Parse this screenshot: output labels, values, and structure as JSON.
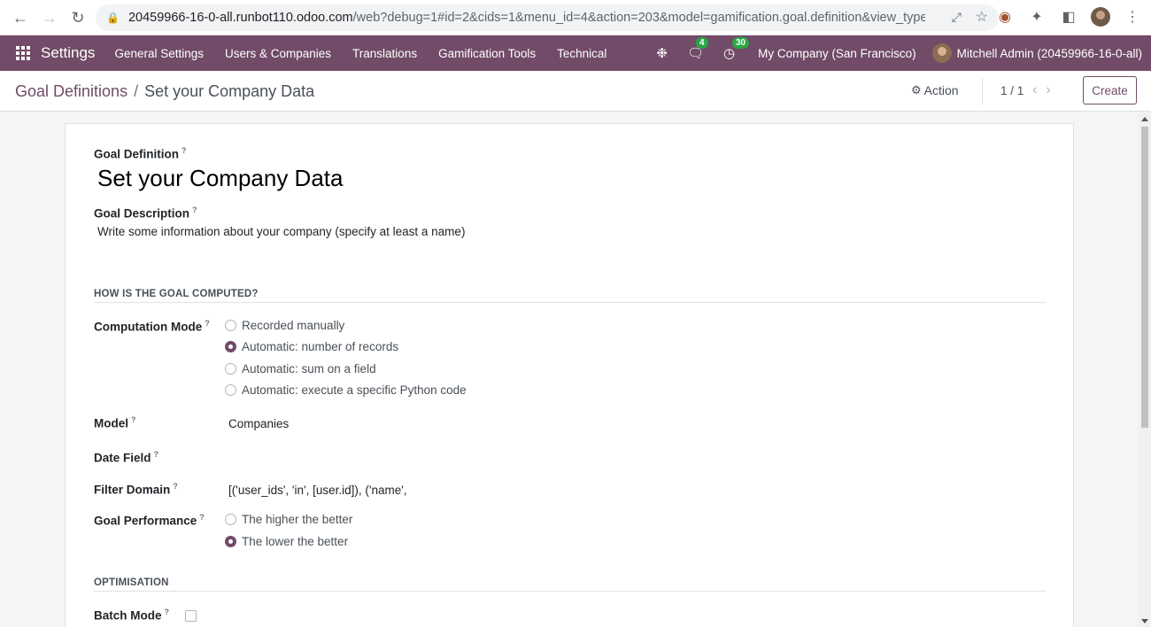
{
  "browser": {
    "url_host": "20459966-16-0-all.runbot110.odoo.com",
    "url_rest": "/web?debug=1#id=2&cids=1&menu_id=4&action=203&model=gamification.goal.definition&view_type..."
  },
  "topnav": {
    "app_name": "Settings",
    "menu": [
      "General Settings",
      "Users & Companies",
      "Translations",
      "Gamification Tools",
      "Technical"
    ],
    "messages_count": "4",
    "activities_count": "30",
    "company": "My Company (San Francisco)",
    "user": "Mitchell Admin (20459966-16-0-all)"
  },
  "control": {
    "breadcrumb_parent": "Goal Definitions",
    "breadcrumb_sep": "/",
    "breadcrumb_current": "Set your Company Data",
    "action_label": "Action",
    "pager": "1 / 1",
    "create_label": "Create"
  },
  "form": {
    "goal_definition_label": "Goal Definition",
    "goal_definition_value": "Set your Company Data",
    "goal_description_label": "Goal Description",
    "goal_description_value": "Write some information about your company (specify at least a name)",
    "section_computed": "HOW IS THE GOAL COMPUTED?",
    "computation_mode_label": "Computation Mode",
    "computation_modes": [
      {
        "label": "Recorded manually",
        "selected": false
      },
      {
        "label": "Automatic: number of records",
        "selected": true
      },
      {
        "label": "Automatic: sum on a field",
        "selected": false
      },
      {
        "label": "Automatic: execute a specific Python code",
        "selected": false
      }
    ],
    "model_label": "Model",
    "model_value": "Companies",
    "date_field_label": "Date Field",
    "filter_domain_label": "Filter Domain",
    "filter_domain_value": "[('user_ids', 'in', [user.id]), ('name',",
    "goal_performance_label": "Goal Performance",
    "goal_performance_options": [
      {
        "label": "The higher the better",
        "selected": false
      },
      {
        "label": "The lower the better",
        "selected": true
      }
    ],
    "section_optimisation": "OPTIMISATION",
    "batch_mode_label": "Batch Mode",
    "batch_mode_checked": false,
    "tooltip_mark": "?"
  },
  "colors": {
    "brand": "#714b67",
    "badge": "#28a745"
  }
}
